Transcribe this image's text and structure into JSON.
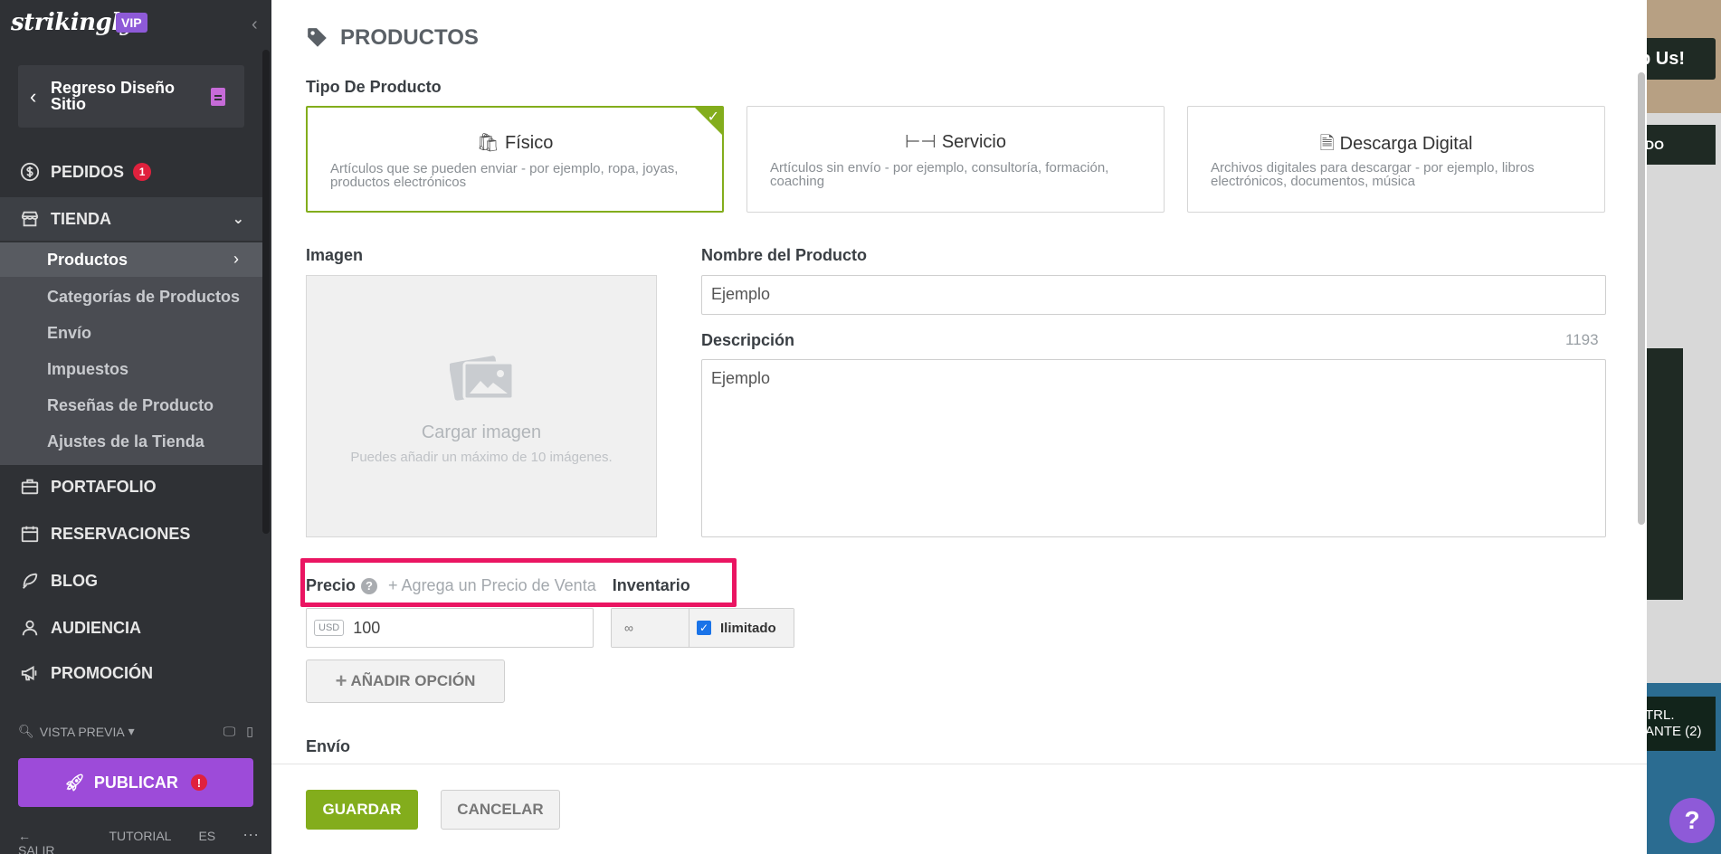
{
  "sidebar": {
    "logo": "strikingly",
    "vip_badge": "VIP",
    "back_label": "Regreso Diseño Sitio",
    "nav": {
      "orders": {
        "label": "PEDIDOS",
        "badge": "1",
        "icon": "dollar-circle-icon"
      },
      "store": {
        "label": "TIENDA",
        "icon": "store-icon"
      },
      "portfolio": {
        "label": "PORTAFOLIO",
        "icon": "briefcase-icon"
      },
      "bookings": {
        "label": "RESERVACIONES",
        "icon": "calendar-icon"
      },
      "blog": {
        "label": "BLOG",
        "icon": "feather-icon"
      },
      "audience": {
        "label": "AUDIENCIA",
        "icon": "user-icon"
      },
      "promotion": {
        "label": "PROMOCIÓN",
        "icon": "megaphone-icon"
      }
    },
    "store_items": [
      {
        "label": "Productos"
      },
      {
        "label": "Categorías de Productos"
      },
      {
        "label": "Envío"
      },
      {
        "label": "Impuestos"
      },
      {
        "label": "Reseñas de Producto"
      },
      {
        "label": "Ajustes de la Tienda"
      }
    ],
    "preview": "VISTA PREVIA",
    "publish": "PUBLICAR",
    "publish_alert": "!",
    "bottom": {
      "exit": "SALIR",
      "tutorial": "TUTORIAL",
      "lang": "ES",
      "more": "···"
    }
  },
  "background": {
    "btn_top": "p Us!",
    "btn_mid": "DO",
    "ctrl_line1": "TRL.",
    "ctrl_line2": "ANTE (2)",
    "help": "?"
  },
  "panel": {
    "title": "PRODUCTOS",
    "product_type_label": "Tipo De Producto",
    "types": [
      {
        "title": "Físico",
        "desc": "Artículos que se pueden enviar - por ejemplo, ropa, joyas, productos electrónicos",
        "selected": true
      },
      {
        "title": "Servicio",
        "desc": "Artículos sin envío - por ejemplo, consultoría, formación, coaching",
        "selected": false
      },
      {
        "title": "Descarga Digital",
        "desc": "Archivos digitales para descargar - por ejemplo, libros electrónicos, documentos, música",
        "selected": false
      }
    ],
    "image_label": "Imagen",
    "upload_title": "Cargar imagen",
    "upload_sub": "Puedes añadir un máximo de 10 imágenes.",
    "name_label": "Nombre del Producto",
    "name_value": "Ejemplo",
    "desc_label": "Descripción",
    "desc_counter": "1193",
    "desc_value": "Ejemplo",
    "price_label": "Precio",
    "price_help": "?",
    "sale_price_link": "+ Agrega un Precio de Venta",
    "inventory_label": "Inventario",
    "currency": "USD",
    "price_value": "100",
    "inventory_value": "∞",
    "unlimited_label": "Ilimitado",
    "add_option": "AÑADIR OPCIÓN",
    "shipping_label": "Envío",
    "save": "GUARDAR",
    "cancel": "CANCELAR"
  },
  "colors": {
    "accent_green": "#83ad1c",
    "brand_purple": "#9d4bd9",
    "highlight_pink": "#ea1562"
  }
}
